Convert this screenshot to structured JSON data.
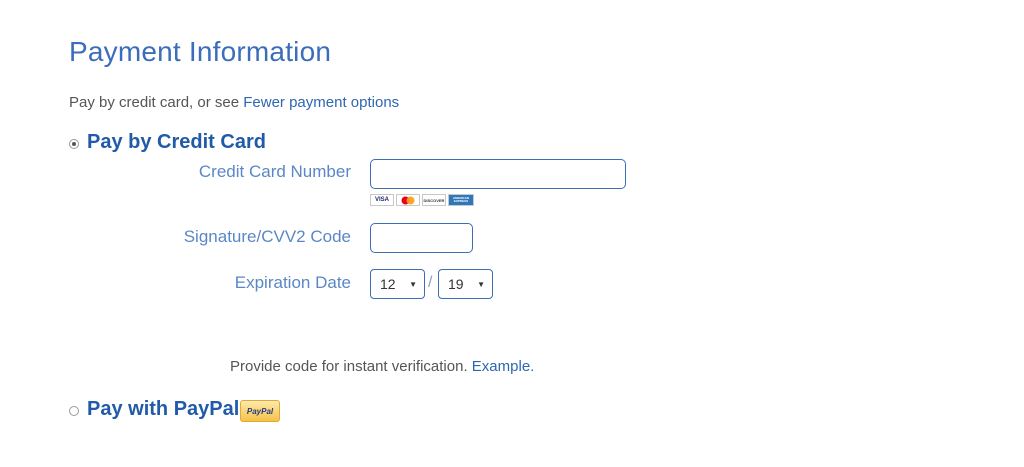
{
  "header": {
    "title": "Payment Information",
    "subtitle_text": "Pay by credit card, or see ",
    "subtitle_link": "Fewer payment options"
  },
  "credit_card": {
    "label": "Pay by Credit Card",
    "selected": true,
    "card_number_label": "Credit Card Number",
    "card_number_value": "",
    "card_logos": [
      "VISA",
      "MasterCard",
      "DISCOVER",
      "AMERICAN EXPRESS"
    ],
    "cvv_label": "Signature/CVV2 Code",
    "cvv_value": "",
    "expiration_label": "Expiration Date",
    "expiration_month": "12",
    "expiration_separator": "/",
    "expiration_year": "19"
  },
  "verification": {
    "text": "Provide code for instant verification. ",
    "link": "Example."
  },
  "paypal": {
    "label": "Pay with PayPal",
    "selected": false,
    "badge_text": "PayPal"
  },
  "colors": {
    "heading_blue": "#3b6dbb",
    "link_blue": "#2e67b1",
    "label_blue": "#5b87c5",
    "text_gray": "#555555"
  }
}
